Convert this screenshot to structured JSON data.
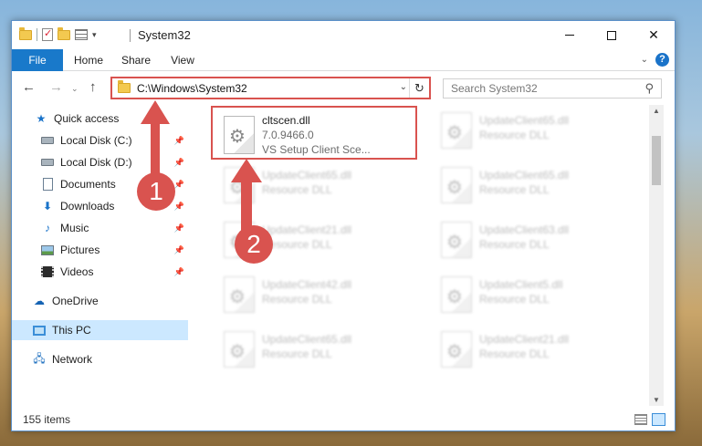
{
  "window": {
    "title": "System32",
    "qat_dropdown_glyph": "▾"
  },
  "ribbon": {
    "tabs": [
      {
        "label": "File"
      },
      {
        "label": "Home"
      },
      {
        "label": "Share"
      },
      {
        "label": "View"
      }
    ]
  },
  "navigation": {
    "address_path": "C:\\Windows\\System32",
    "search_placeholder": "Search System32"
  },
  "sidebar": {
    "items": [
      {
        "label": "Quick access",
        "icon": "star-icon",
        "pinned": false
      },
      {
        "label": "Local Disk (C:)",
        "icon": "disk-icon",
        "pinned": true
      },
      {
        "label": "Local Disk (D:)",
        "icon": "disk-icon",
        "pinned": true
      },
      {
        "label": "Documents",
        "icon": "documents-icon",
        "pinned": true
      },
      {
        "label": "Downloads",
        "icon": "downloads-icon",
        "pinned": true
      },
      {
        "label": "Music",
        "icon": "music-icon",
        "pinned": true
      },
      {
        "label": "Pictures",
        "icon": "pictures-icon",
        "pinned": true
      },
      {
        "label": "Videos",
        "icon": "videos-icon",
        "pinned": true
      },
      {
        "label": "OneDrive",
        "icon": "onedrive-icon",
        "pinned": false
      },
      {
        "label": "This PC",
        "icon": "this-pc-icon",
        "pinned": false,
        "selected": true
      },
      {
        "label": "Network",
        "icon": "network-icon",
        "pinned": false
      }
    ]
  },
  "files": {
    "highlighted": {
      "name": "cltscen.dll",
      "version": "7.0.9466.0",
      "description": "VS Setup Client Sce..."
    },
    "left_column": [
      {
        "name": "UpdateClient65.dll",
        "type": "Resource DLL"
      },
      {
        "name": "UpdateClient21.dll",
        "type": "Resource DLL"
      },
      {
        "name": "UpdateClient42.dll",
        "type": "Resource DLL"
      },
      {
        "name": "UpdateClient65.dll",
        "type": "Resource DLL"
      }
    ],
    "right_column": [
      {
        "name": "UpdateClient65.dll",
        "type": "Resource DLL"
      },
      {
        "name": "UpdateClient65.dll",
        "type": "Resource DLL"
      },
      {
        "name": "UpdateClient63.dll",
        "type": "Resource DLL"
      },
      {
        "name": "UpdateClient5.dll",
        "type": "Resource DLL"
      },
      {
        "name": "UpdateClient21.dll",
        "type": "Resource DLL"
      }
    ]
  },
  "annotations": {
    "step1": "1",
    "step2": "2",
    "color": "#d9534f"
  },
  "status": {
    "item_count": "155 items"
  },
  "colors": {
    "accent": "#1979ca",
    "selected_bg": "#cce8ff",
    "annotation_red": "#d9534f"
  }
}
